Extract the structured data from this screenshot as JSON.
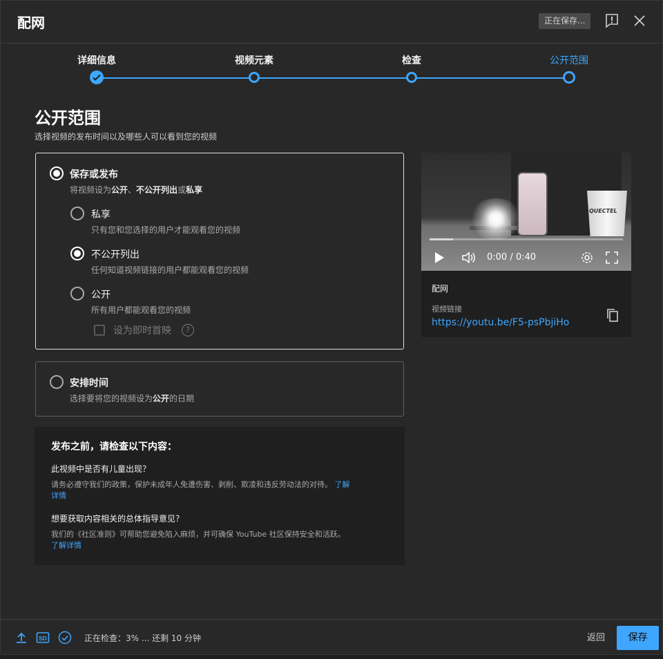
{
  "header": {
    "title": "配网",
    "saving_chip": "正在保存...",
    "feedback_icon": "feedback-icon",
    "close_icon": "close-icon"
  },
  "stepper": {
    "steps": [
      {
        "label": "详细信息",
        "state": "done"
      },
      {
        "label": "视频元素",
        "state": "todo"
      },
      {
        "label": "检查",
        "state": "todo"
      },
      {
        "label": "公开范围",
        "state": "current"
      }
    ],
    "accent": "#3ea6ff"
  },
  "visibility": {
    "title": "公开范围",
    "subtitle": "选择视频的发布时间以及哪些人可以看到您的视频",
    "save_or_publish": {
      "label": "保存或发布",
      "desc_prefix": "将视频设为",
      "desc_b1": "公开",
      "desc_sep1": "、",
      "desc_b2": "不公开列出",
      "desc_sep2": "或",
      "desc_b3": "私享",
      "selected": true
    },
    "options": [
      {
        "label": "私享",
        "desc": "只有您和您选择的用户才能观看您的视频",
        "selected": false
      },
      {
        "label": "不公开列出",
        "desc": "任何知道视频链接的用户都能观看您的视频",
        "selected": true
      },
      {
        "label": "公开",
        "desc": "所有用户都能观看您的视频",
        "selected": false
      }
    ],
    "premiere": {
      "label": "设为即时首映",
      "help": "?",
      "checked": false
    },
    "schedule": {
      "label": "安排时间",
      "desc_prefix": "选择要将您的视频设为",
      "desc_bold": "公开",
      "desc_suffix": "的日期",
      "selected": false
    }
  },
  "info": {
    "title": "发布之前，请检查以下内容：",
    "q1": "此视频中是否有儿童出现？",
    "t1": "请务必遵守我们的政策，保护未成年人免遭伤害、剥削、欺凌和违反劳动法的对待。",
    "link1": "了解详情",
    "q2": "想要获取内容相关的总体指导意见？",
    "t2": "我们的《社区准则》可帮助您避免陷入麻烦，并可确保 YouTube 社区保持安全和活跃。",
    "link2": "了解详情"
  },
  "video": {
    "time": "0:00 / 0:40",
    "progress": 0.12,
    "cup_text": "QUECTEL",
    "name": "配网",
    "link_label": "视频链接",
    "url": "https://youtu.be/F5-psPbjiHo"
  },
  "footer": {
    "status": "正在检查：3% ... 还剩 10 分钟",
    "sd_badge": "SD",
    "back": "返回",
    "save": "保存"
  }
}
